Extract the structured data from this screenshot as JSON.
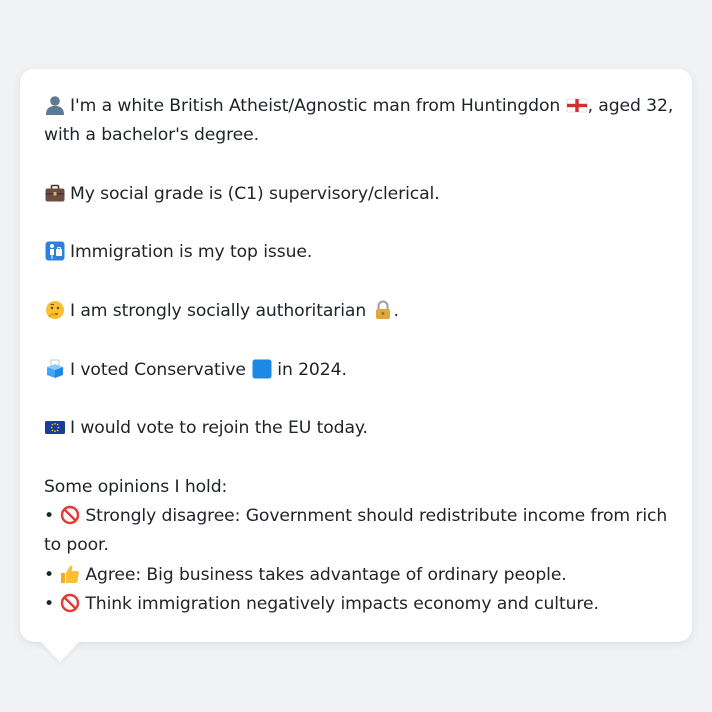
{
  "profile": {
    "identity_line1": "I'm a white British Atheist/Agnostic man from Huntingdon",
    "identity_line1_end": ", aged 32,",
    "identity_line2": "with a bachelor's degree.",
    "social_grade": "My social grade is (C1) supervisory/clerical.",
    "top_issue": "Immigration is my top issue.",
    "social_stance": "I am strongly socially authoritarian",
    "social_stance_end": ".",
    "vote_2024_prefix": "I voted Conservative",
    "vote_2024_suffix": "in 2024.",
    "eu_vote": "I would vote to rejoin the EU today."
  },
  "opinions": {
    "heading": "Some opinions I hold:",
    "items": [
      {
        "bullet": "•",
        "icon": "prohibited-icon",
        "text": "Strongly disagree: Government should redistribute income from rich to poor."
      },
      {
        "bullet": "•",
        "icon": "thumbs-up-icon",
        "text": "Agree: Big business takes advantage of ordinary people."
      },
      {
        "bullet": "•",
        "icon": "prohibited-icon",
        "text": "Think immigration negatively impacts economy and culture."
      }
    ]
  },
  "icons": {
    "person": "person-silhouette-icon",
    "england_flag": "england-flag-icon",
    "briefcase": "briefcase-icon",
    "passport_control": "passport-control-icon",
    "thinking_face": "thinking-face-icon",
    "lock": "lock-icon",
    "ballot_box": "ballot-box-icon",
    "blue_square": "blue-square-icon",
    "eu_flag": "eu-flag-icon"
  },
  "colors": {
    "background": "#f1f2f4",
    "card": "#ffffff",
    "text": "#1e2329",
    "conservative_blue": "#1e88e5",
    "prohibited_red": "#e53935",
    "eu_blue": "#1a3d9c"
  }
}
